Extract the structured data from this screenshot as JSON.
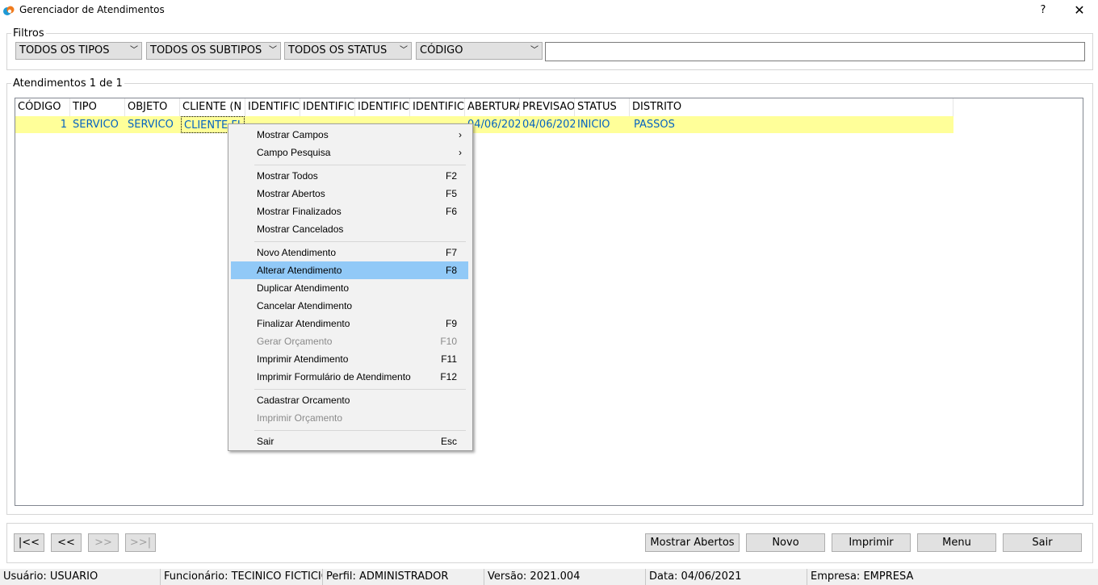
{
  "window": {
    "title": "Gerenciador de Atendimentos",
    "help": "?",
    "close": "✕"
  },
  "filters": {
    "label": "Filtros",
    "tipos": "TODOS OS TIPOS",
    "subtipos": "TODOS OS SUBTIPOS",
    "status": "TODOS OS STATUS",
    "campo": "CÓDIGO",
    "search_value": ""
  },
  "list": {
    "label": "Atendimentos 1 de 1",
    "columns": [
      "CÓDIGO",
      "TIPO",
      "OBJETO",
      "CLIENTE (N",
      "IDENTIFIC",
      "IDENTIFIC",
      "IDENTIFIC",
      "IDENTIFIC",
      "ABERTURA",
      "PREVISAO",
      "STATUS",
      "DISTRITO"
    ],
    "rows": [
      [
        "1",
        "SERVICO",
        "SERVICO",
        "CLIENTE FI",
        "",
        "",
        "",
        "",
        "04/06/202",
        "04/06/202",
        "INICIO",
        "PASSOS"
      ]
    ]
  },
  "context_menu": {
    "items": [
      {
        "label": "Mostrar Campos",
        "submenu": "›"
      },
      {
        "label": "Campo Pesquisa",
        "submenu": "›"
      },
      {
        "label": "Mostrar Todos",
        "key": "F2"
      },
      {
        "label": "Mostrar Abertos",
        "key": "F5"
      },
      {
        "label": "Mostrar Finalizados",
        "key": "F6"
      },
      {
        "label": "Mostrar Cancelados",
        "key": ""
      },
      {
        "label": "Novo Atendimento",
        "key": "F7"
      },
      {
        "label": "Alterar Atendimento",
        "key": "F8"
      },
      {
        "label": "Duplicar Atendimento",
        "key": ""
      },
      {
        "label": "Cancelar Atendimento",
        "key": ""
      },
      {
        "label": "Finalizar Atendimento",
        "key": "F9"
      },
      {
        "label": "Gerar Orçamento",
        "key": "F10"
      },
      {
        "label": "Imprimir Atendimento",
        "key": "F11"
      },
      {
        "label": "Imprimir Formulário de Atendimento",
        "key": "F12"
      },
      {
        "label": "Cadastrar Orcamento",
        "key": ""
      },
      {
        "label": "Imprimir Orçamento",
        "key": ""
      },
      {
        "label": "Sair",
        "key": "Esc"
      }
    ]
  },
  "nav": {
    "first": "|<<",
    "prev": "<<",
    "next": ">>",
    "last": ">>|"
  },
  "actions": {
    "mostrar_abertos": "Mostrar Abertos",
    "novo": "Novo",
    "imprimir": "Imprimir",
    "menu": "Menu",
    "sair": "Sair"
  },
  "status": {
    "usuario": "Usuário: USUARIO",
    "funcionario": "Funcionário: TECINICO FICTICIO",
    "perfil": "Perfil: ADMINISTRADOR",
    "versao": "Versão: 2021.004",
    "data": "Data: 04/06/2021",
    "empresa": "Empresa: EMPRESA"
  },
  "colors": {
    "row_highlight": "#ffff99",
    "link_text": "#0563c1",
    "menu_selected": "#91c9f7"
  },
  "icons": {
    "app": "app-logo-icon",
    "dropdown": "chevron-down-icon",
    "submenu": "chevron-right-icon"
  }
}
